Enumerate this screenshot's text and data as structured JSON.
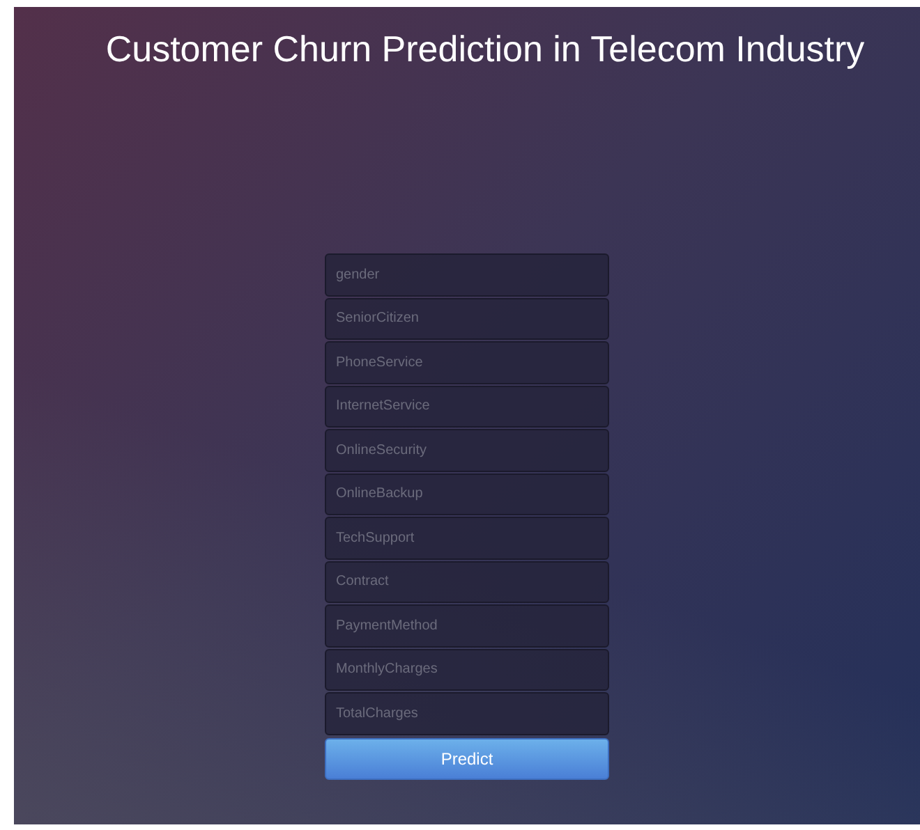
{
  "title": "Customer Churn Prediction in Telecom Industry",
  "fields": [
    {
      "placeholder": "gender"
    },
    {
      "placeholder": "SeniorCitizen"
    },
    {
      "placeholder": "PhoneService"
    },
    {
      "placeholder": "InternetService"
    },
    {
      "placeholder": "OnlineSecurity"
    },
    {
      "placeholder": "OnlineBackup"
    },
    {
      "placeholder": "TechSupport"
    },
    {
      "placeholder": "Contract"
    },
    {
      "placeholder": "PaymentMethod"
    },
    {
      "placeholder": "MonthlyCharges"
    },
    {
      "placeholder": "TotalCharges"
    }
  ],
  "button": "Predict"
}
